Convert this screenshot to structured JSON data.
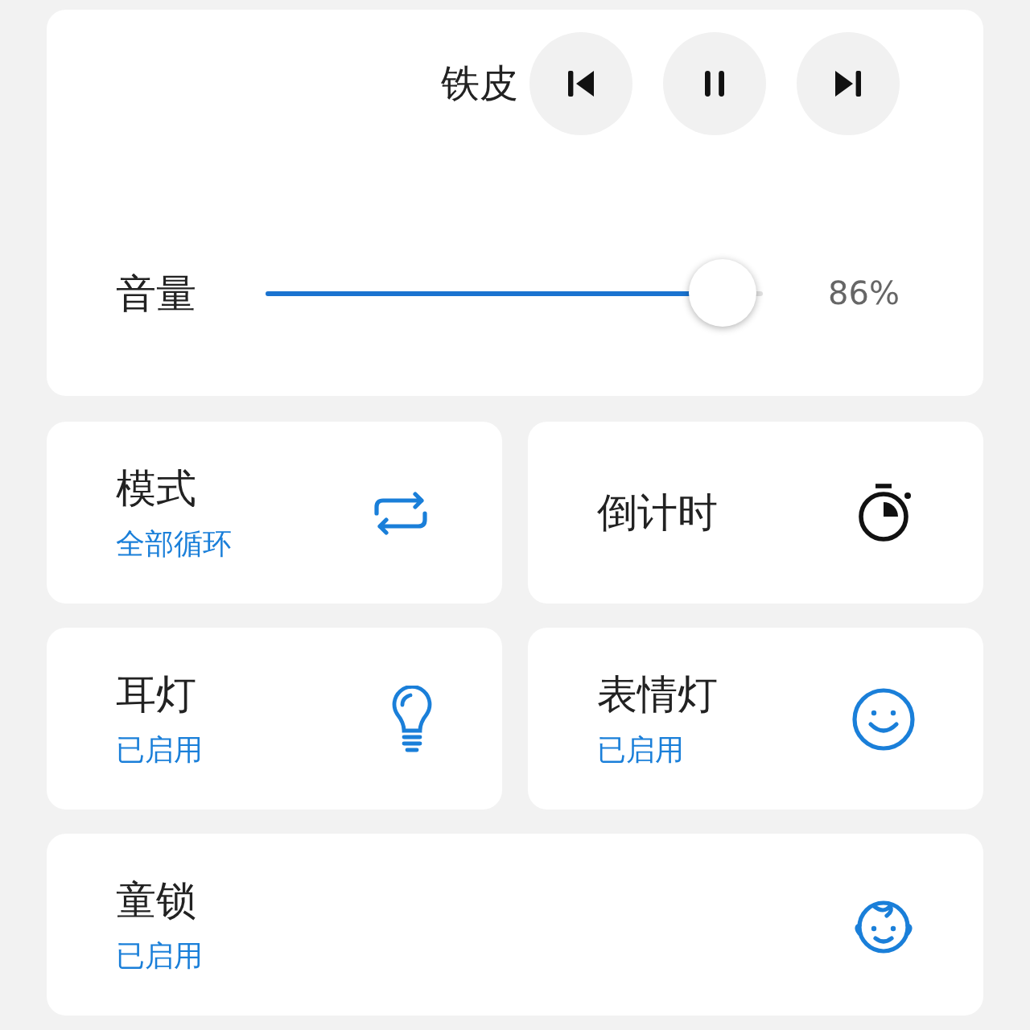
{
  "player": {
    "title": "铁皮",
    "volume": {
      "label": "音量",
      "level": 0.86,
      "reading": "86%"
    }
  },
  "tiles": [
    {
      "title": "模式",
      "status": "全部循环"
    },
    {
      "title": "倒计时"
    },
    {
      "title": "耳灯",
      "status": "已启用"
    },
    {
      "title": "表情灯",
      "status": "已启用"
    },
    {
      "title": "童锁",
      "status": "已启用"
    }
  ]
}
